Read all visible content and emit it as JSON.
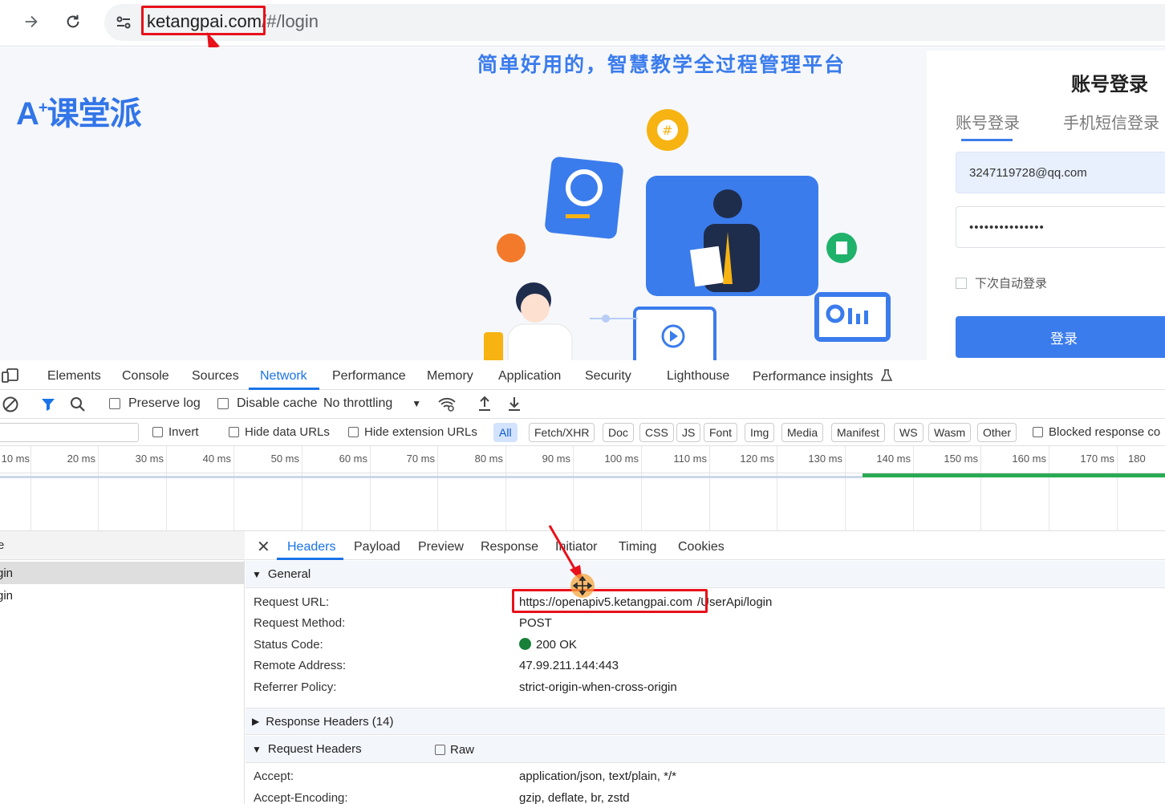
{
  "browser": {
    "url_domain": "ketangpai.com",
    "url_path": "/#/login",
    "back_icon": "arrow-right-icon",
    "reload_icon": "reload-icon",
    "site_info_icon": "tune-icon"
  },
  "page": {
    "slogan": "简单好用的，智慧教学全过程管理平台",
    "logo_text": "课堂派",
    "logo_mark": "A",
    "logo_plus": "+",
    "login": {
      "title": "账号登录",
      "tabs": [
        "账号登录",
        "手机短信登录"
      ],
      "account_value": "3247119728@qq.com",
      "password_value": "•••••••••••••••",
      "remember_label": "下次自动登录",
      "submit_label": "登录"
    }
  },
  "devtools": {
    "tabs": [
      "Elements",
      "Console",
      "Sources",
      "Network",
      "Performance",
      "Memory",
      "Application",
      "Security",
      "Lighthouse",
      "Performance insights"
    ],
    "active_tab": "Network",
    "toolbar": {
      "preserve_log": "Preserve log",
      "disable_cache": "Disable cache",
      "throttling": "No throttling"
    },
    "filters": {
      "invert": "Invert",
      "hide_data_urls": "Hide data URLs",
      "hide_extension_urls": "Hide extension URLs",
      "types": [
        "All",
        "Fetch/XHR",
        "Doc",
        "CSS",
        "JS",
        "Font",
        "Img",
        "Media",
        "Manifest",
        "WS",
        "Wasm",
        "Other"
      ],
      "active_type": "All",
      "blocked": "Blocked response co"
    },
    "timeline_ticks": [
      "10 ms",
      "20 ms",
      "30 ms",
      "40 ms",
      "50 ms",
      "60 ms",
      "70 ms",
      "80 ms",
      "90 ms",
      "100 ms",
      "110 ms",
      "120 ms",
      "130 ms",
      "140 ms",
      "150 ms",
      "160 ms",
      "170 ms",
      "180"
    ],
    "requests": [
      "gin",
      "gin"
    ],
    "detail_tabs": [
      "Headers",
      "Payload",
      "Preview",
      "Response",
      "Initiator",
      "Timing",
      "Cookies"
    ],
    "active_detail_tab": "Headers",
    "general": {
      "section_label": "General",
      "rows": [
        {
          "key": "Request URL:",
          "value_host": "https://openapiv5.ketangpai.com",
          "value_path": "/UserApi/login"
        },
        {
          "key": "Request Method:",
          "value": "POST"
        },
        {
          "key": "Status Code:",
          "value": "200 OK",
          "status_color": "#188038"
        },
        {
          "key": "Remote Address:",
          "value": "47.99.211.144:443"
        },
        {
          "key": "Referrer Policy:",
          "value": "strict-origin-when-cross-origin"
        }
      ]
    },
    "response_headers_label": "Response Headers (14)",
    "request_headers_label": "Request Headers",
    "raw_label": "Raw",
    "request_headers": [
      {
        "key": "Accept:",
        "value": "application/json, text/plain, */*"
      },
      {
        "key": "Accept-Encoding:",
        "value": "gzip, deflate, br, zstd"
      }
    ]
  },
  "colors": {
    "brand_blue": "#3b7cec",
    "devtools_active": "#1a73e8",
    "highlight_red": "#e8111a",
    "status_green": "#188038"
  }
}
